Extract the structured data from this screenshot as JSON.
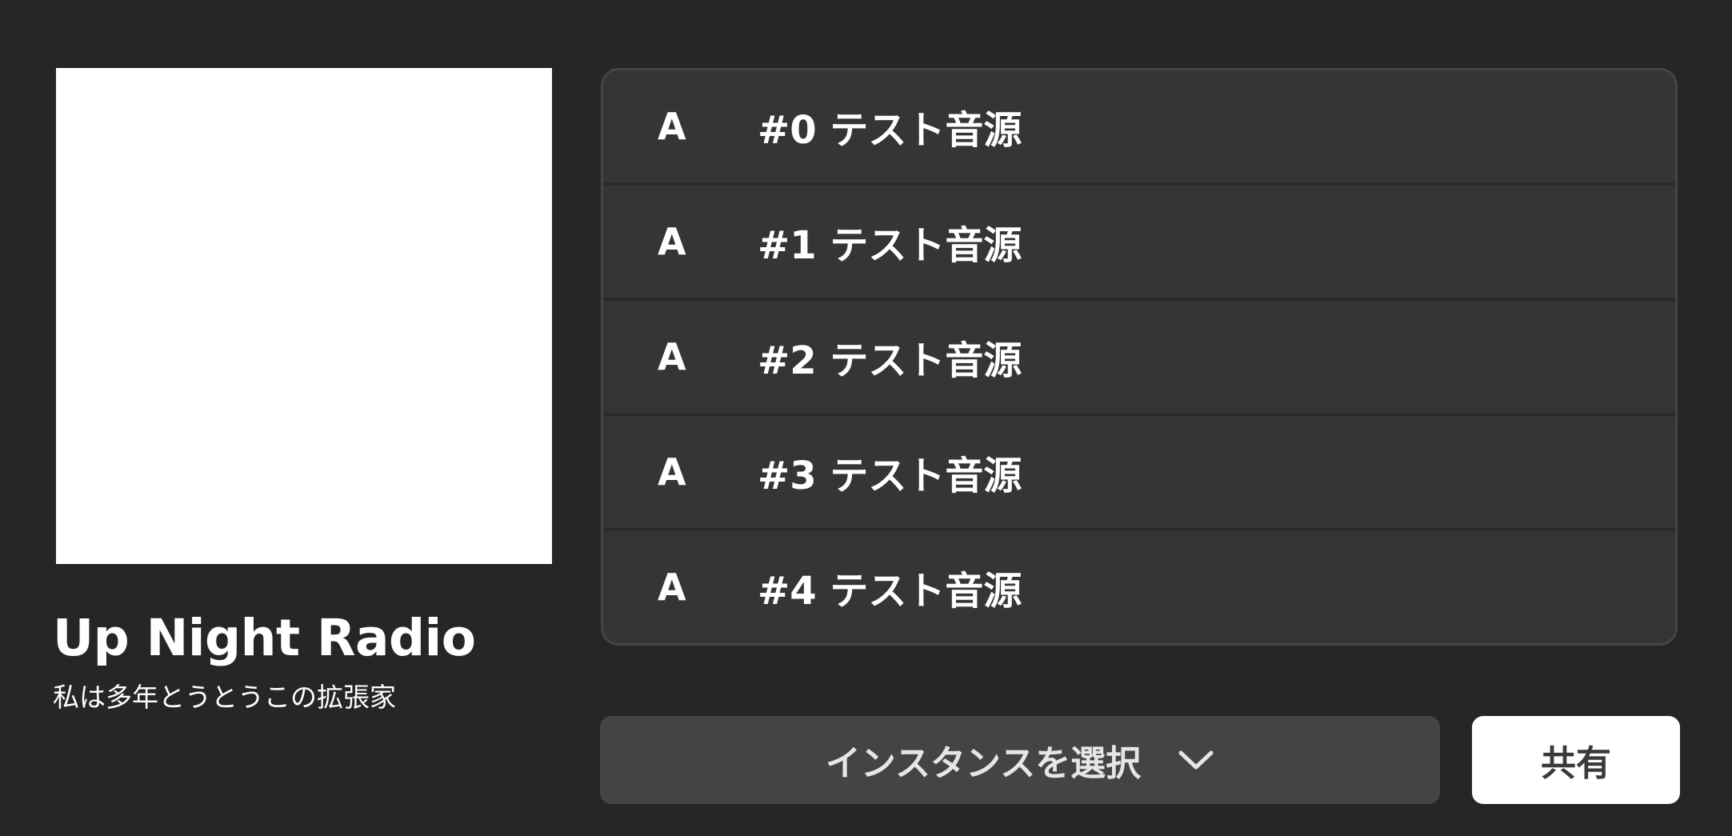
{
  "player": {
    "title": "Up Night Radio",
    "description": "私は多年とうとうこの拡張家"
  },
  "tracks": [
    {
      "badge": "A",
      "name": "#0 テスト音源"
    },
    {
      "badge": "A",
      "name": "#1 テスト音源"
    },
    {
      "badge": "A",
      "name": "#2 テスト音源"
    },
    {
      "badge": "A",
      "name": "#3 テスト音源"
    },
    {
      "badge": "A",
      "name": "#4 テスト音源"
    }
  ],
  "controls": {
    "instance_select_label": "インスタンスを選択",
    "instance_select_icon": "chevron-down-icon",
    "share_label": "共有"
  },
  "colors": {
    "background": "#262626",
    "track_list_bg": "#353535",
    "select_bg": "#444444",
    "share_bg": "#ffffff",
    "artwork_bg": "#ffffff"
  }
}
